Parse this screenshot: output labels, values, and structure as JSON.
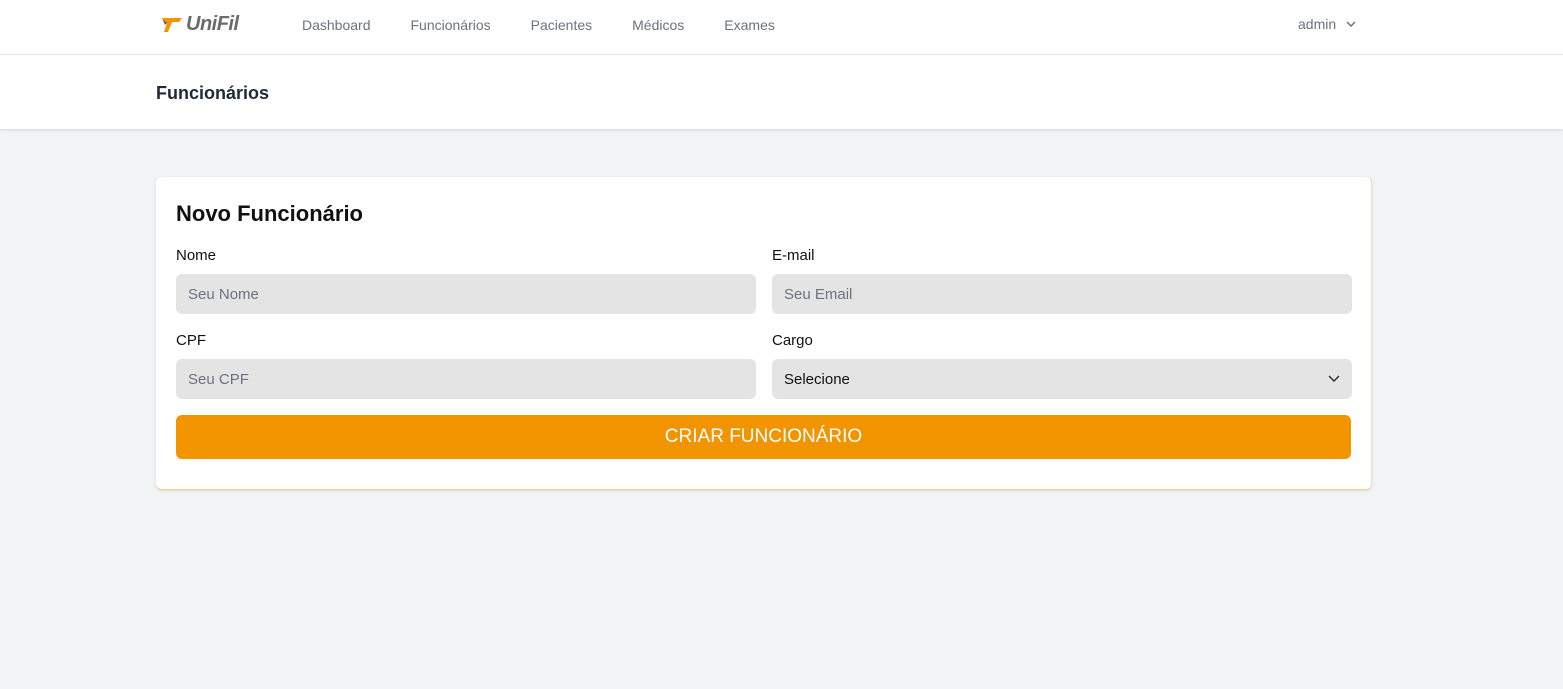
{
  "nav": {
    "logo": "UniFil",
    "links": [
      "Dashboard",
      "Funcionários",
      "Pacientes",
      "Médicos",
      "Exames"
    ],
    "user": "admin"
  },
  "header": {
    "title": "Funcionários"
  },
  "form": {
    "title": "Novo Funcionário",
    "nome": {
      "label": "Nome",
      "placeholder": "Seu Nome"
    },
    "email": {
      "label": "E-mail",
      "placeholder": "Seu Email"
    },
    "cpf": {
      "label": "CPF",
      "placeholder": "Seu CPF"
    },
    "cargo": {
      "label": "Cargo",
      "value": "Selecione"
    },
    "submit": "CRIAR FUNCIONÁRIO"
  },
  "colors": {
    "accent": "#f29400"
  }
}
